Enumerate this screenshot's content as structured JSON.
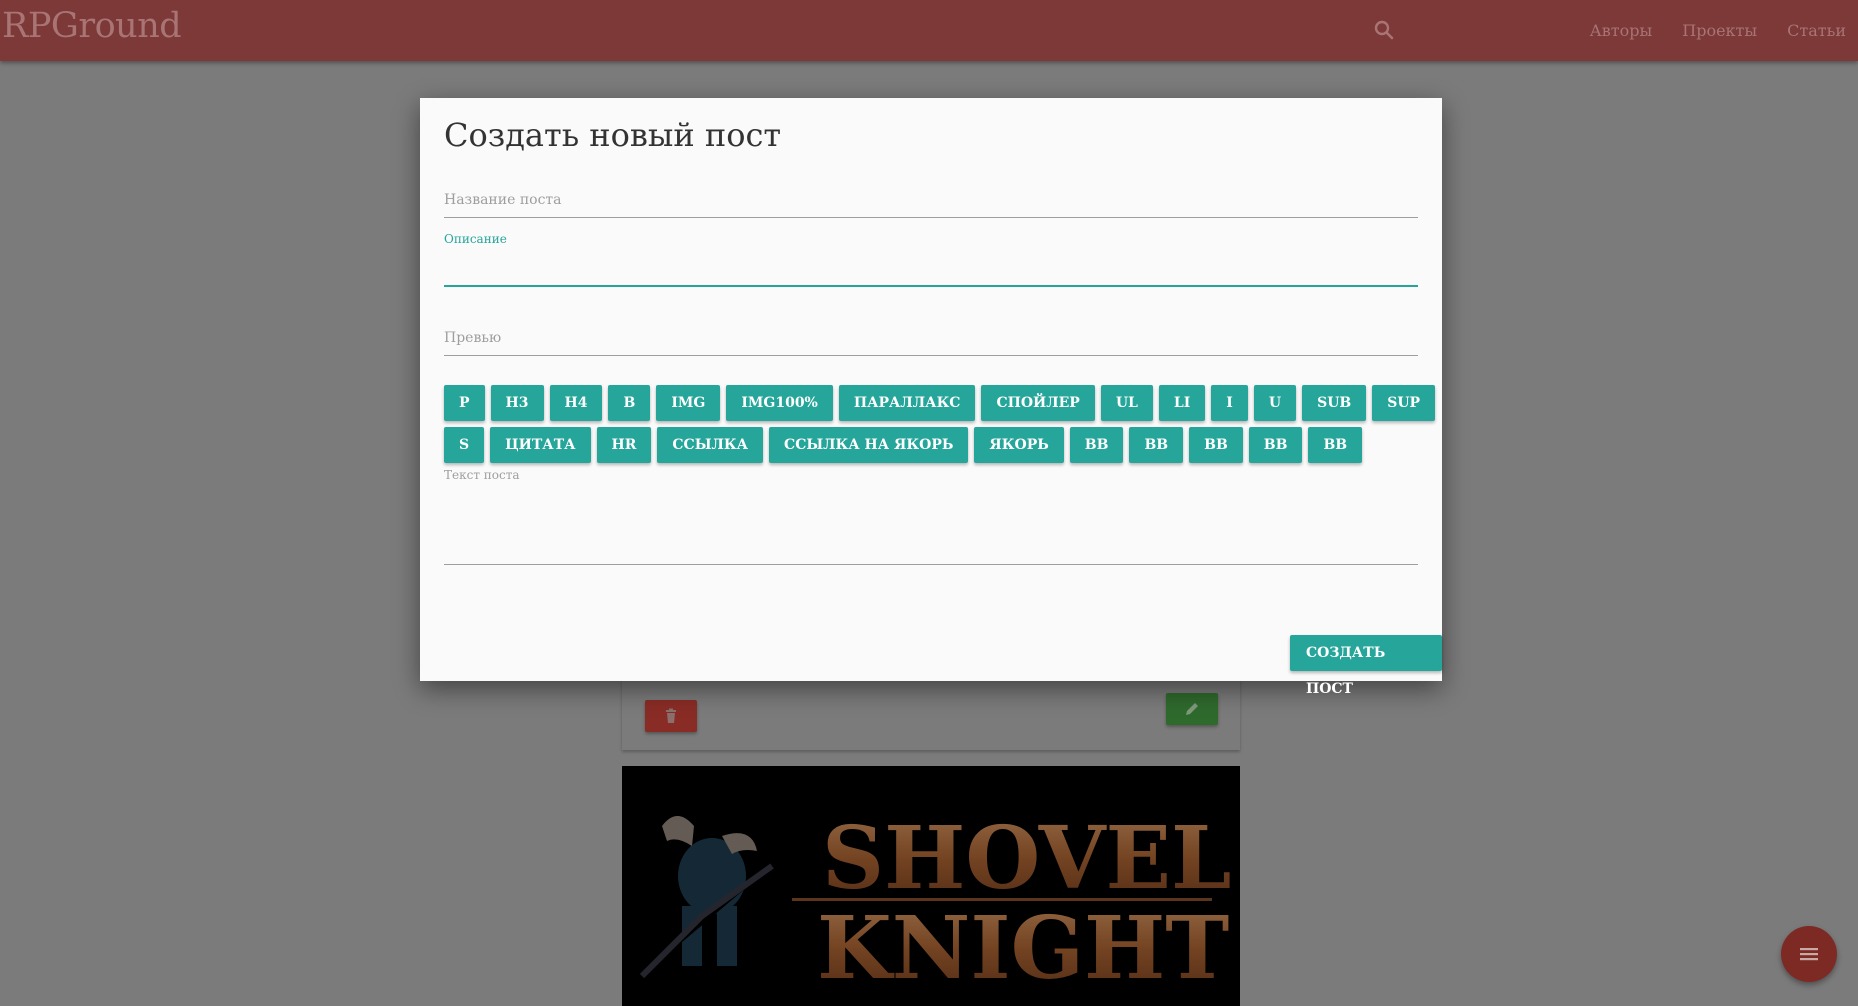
{
  "header": {
    "brand": "RPGround",
    "nav": [
      "Авторы",
      "Проекты",
      "Статьи"
    ]
  },
  "modal": {
    "title": "Создать новый пост",
    "fields": {
      "title_label": "Название поста",
      "description_label": "Описание",
      "preview_label": "Превью",
      "body_label": "Текст поста"
    },
    "toolbar_row1": [
      "P",
      "H3",
      "H4",
      "B",
      "IMG",
      "IMG100%",
      "ПАРАЛЛАКС",
      "СПОЙЛЕР",
      "UL",
      "LI",
      "I",
      "U",
      "SUB",
      "SUP"
    ],
    "toolbar_row2": [
      "S",
      "ЦИТАТА",
      "HR",
      "ССЫЛКА",
      "ССЫЛКА НА ЯКОРЬ",
      "ЯКОРЬ",
      "BB",
      "BB",
      "BB",
      "BB",
      "BB"
    ],
    "submit_label": "СОЗДАТЬ ПОСТ"
  },
  "colors": {
    "accent": "#26a69a",
    "navbar": "#7d3838",
    "delete": "#8a2c26",
    "edit": "#2f6a2d"
  },
  "icons": {
    "search": "search-icon",
    "delete": "trash-icon",
    "edit": "pencil-icon",
    "fab": "menu-icon"
  },
  "background_image": {
    "logo_line1": "SHOVEL",
    "logo_line2": "KNIGHT"
  }
}
